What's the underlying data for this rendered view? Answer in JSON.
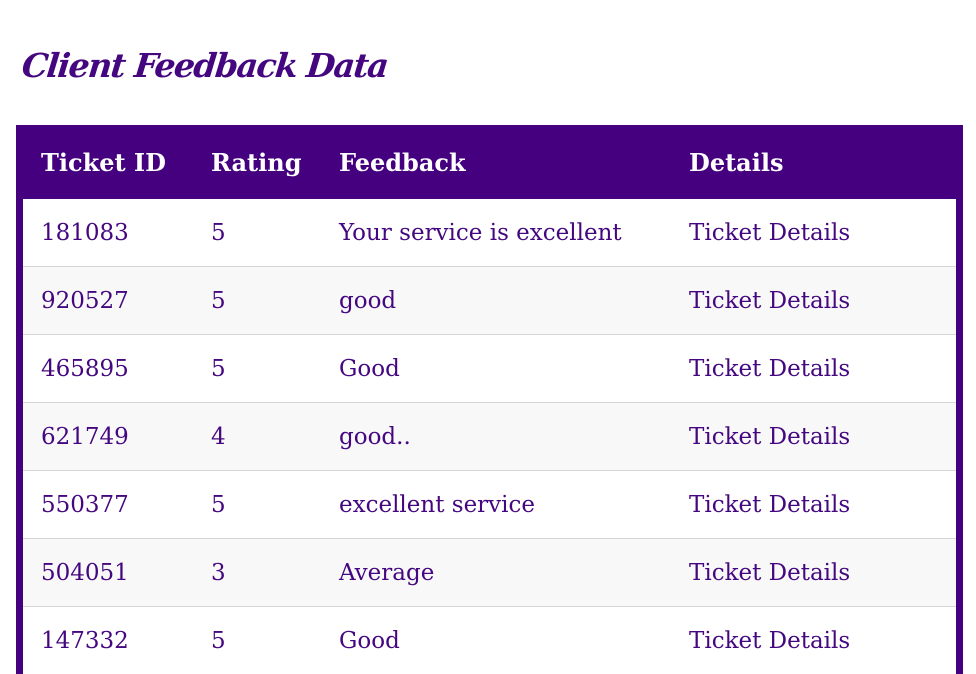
{
  "page": {
    "title": "Client Feedback Data"
  },
  "table": {
    "headers": {
      "ticket_id": "Ticket ID",
      "rating": "Rating",
      "feedback": "Feedback",
      "details": "Details"
    },
    "rows": [
      {
        "ticket_id": "181083",
        "rating": "5",
        "feedback": "Your service is excellent",
        "details": "Ticket Details"
      },
      {
        "ticket_id": "920527",
        "rating": "5",
        "feedback": "good",
        "details": "Ticket Details"
      },
      {
        "ticket_id": "465895",
        "rating": "5",
        "feedback": "Good",
        "details": "Ticket Details"
      },
      {
        "ticket_id": "621749",
        "rating": "4",
        "feedback": "good..",
        "details": "Ticket Details"
      },
      {
        "ticket_id": "550377",
        "rating": "5",
        "feedback": "excellent service",
        "details": "Ticket Details"
      },
      {
        "ticket_id": "504051",
        "rating": "3",
        "feedback": "Average",
        "details": "Ticket Details"
      },
      {
        "ticket_id": "147332",
        "rating": "5",
        "feedback": "Good",
        "details": "Ticket Details"
      }
    ]
  },
  "colors": {
    "accent": "#44007f",
    "text": "#44077f",
    "row_alt": "#f8f8f8",
    "border": "#d6d6d6"
  }
}
